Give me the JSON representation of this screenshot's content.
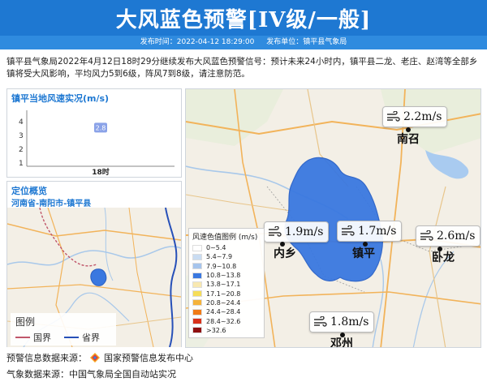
{
  "header": {
    "title": "大风蓝色预警[IV级/一般]",
    "publish_time_label": "发布时间：2022-04-12 18:29:00",
    "publisher_label": "发布单位：镇平县气象局"
  },
  "description": "镇平县气象局2022年4月12日18时29分继续发布大风蓝色预警信号：预计未来24小时内，镇平县二龙、老庄、赵湾等全部乡镇将受大风影响，平均风力5到6级，阵风7到8级，请注意防范。",
  "wind_panel": {
    "title": "镇平当地风速实况(m/s)",
    "chart_data": {
      "type": "scatter",
      "categories": [
        "18时"
      ],
      "values": [
        2.8
      ],
      "title": "镇平当地风速实况(m/s)",
      "ylim": [
        0,
        4
      ],
      "yticks": [
        "1",
        "2",
        "3",
        "4"
      ],
      "point_label": "2.8"
    }
  },
  "location_panel": {
    "title": "定位概览",
    "region": "河南省-南阳市-镇平县",
    "legend_title": "图例",
    "legend_items": [
      {
        "label": "国界",
        "color": "#c0566a"
      },
      {
        "label": "省界",
        "color": "#2750b8"
      }
    ]
  },
  "main_map": {
    "stations": [
      {
        "name": "南召",
        "speed": "2.2m/s"
      },
      {
        "name": "内乡",
        "speed": "1.9m/s"
      },
      {
        "name": "镇平",
        "speed": "1.7m/s"
      },
      {
        "name": "卧龙",
        "speed": "2.6m/s"
      },
      {
        "name": "邓州",
        "speed": "1.8m/s"
      }
    ],
    "legend": {
      "title": "风速色值图例 (m/s)",
      "items": [
        {
          "label": "0~5.4",
          "color": "#ffffff"
        },
        {
          "label": "5.4~7.9",
          "color": "#c9dcf2"
        },
        {
          "label": "7.9~10.8",
          "color": "#a6c4ec"
        },
        {
          "label": "10.8~13.8",
          "color": "#3a78e0"
        },
        {
          "label": "13.8~17.1",
          "color": "#f8e8b0"
        },
        {
          "label": "17.1~20.8",
          "color": "#f5dd5a"
        },
        {
          "label": "20.8~24.4",
          "color": "#f5b23a"
        },
        {
          "label": "24.4~28.4",
          "color": "#f07b16"
        },
        {
          "label": "28.4~32.6",
          "color": "#d8311a"
        },
        {
          "label": ">32.6",
          "color": "#8f1010"
        }
      ]
    },
    "warning_area_color": "#3a78e0"
  },
  "footer": {
    "source_line": "预警信息数据来源：",
    "source_name": "国家预警信息发布中心",
    "weather_line": "气象数据来源：中国气象局全国自动站实况"
  }
}
